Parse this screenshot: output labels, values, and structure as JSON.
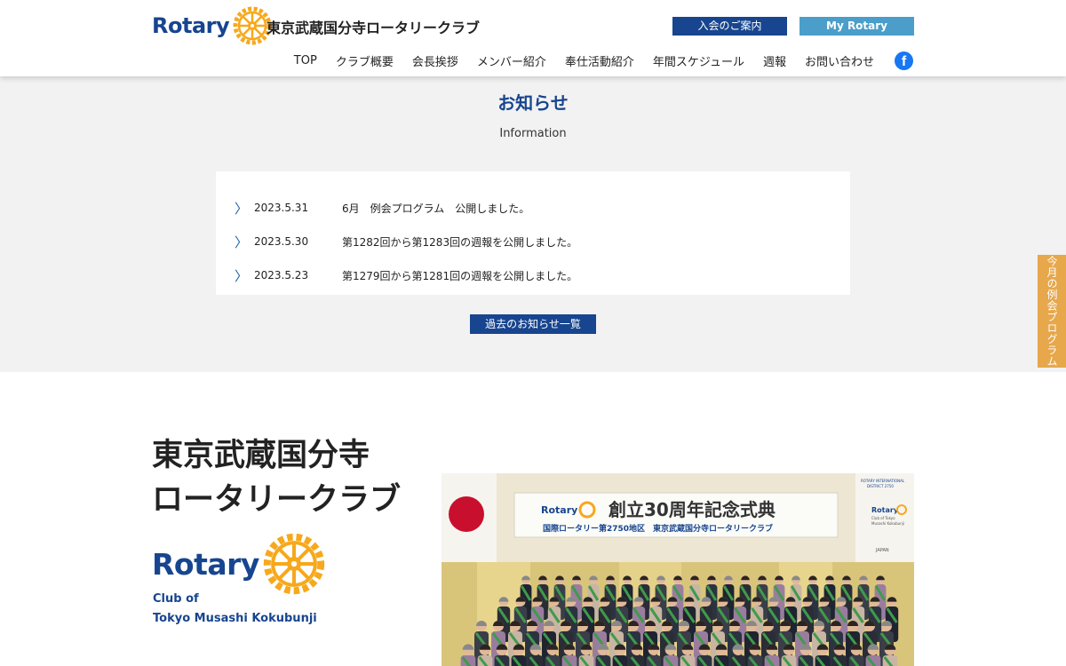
{
  "header": {
    "logo_text": "Rotary",
    "club_name": "東京武蔵国分寺ロータリークラブ",
    "join_button": "入会のご案内",
    "my_rotary_button": "My Rotary",
    "nav": [
      "TOP",
      "クラブ概要",
      "会長挨拶",
      "メンバー紹介",
      "奉仕活動紹介",
      "年間スケジュール",
      "週報",
      "お問い合わせ"
    ],
    "facebook_icon": "f"
  },
  "info": {
    "title": "お知らせ",
    "subtitle": "Information",
    "items": [
      {
        "date": "2023.5.31",
        "text": "6月　例会プログラム　公開しました。"
      },
      {
        "date": "2023.5.30",
        "text": "第1282回から第1283回の週報を公開しました。"
      },
      {
        "date": "2023.5.23",
        "text": "第1279回から第1281回の週報を公開しました。"
      }
    ],
    "more_button": "過去のお知らせ一覧"
  },
  "side_tab": "今月の例会プログラム",
  "intro": {
    "title_line1": "東京武蔵国分寺",
    "title_line2": "ロータリークラブ",
    "logo_text": "Rotary",
    "club_of_line1": "Club of",
    "club_of_line2": "Tokyo Musashi Kokubunji"
  },
  "photo": {
    "banner_logo": "Rotary",
    "banner_title": "創立30周年記念式典",
    "banner_sub": "国際ロータリー第2750地区　東京武蔵国分寺ロータリークラブ",
    "corner_text1": "ROTARY INTERNATIONAL",
    "corner_text2": "DISTRICT 2750",
    "side_logo": "Rotary",
    "side_club1": "Club of Tokyo",
    "side_club2": "Musashi Kokubunji",
    "side_country": "JAPAN"
  },
  "colors": {
    "rotary_blue": "#17458f",
    "rotary_gold": "#f7a81b",
    "my_rotary": "#4a9ec9",
    "side_tab": "#e7a74b"
  }
}
